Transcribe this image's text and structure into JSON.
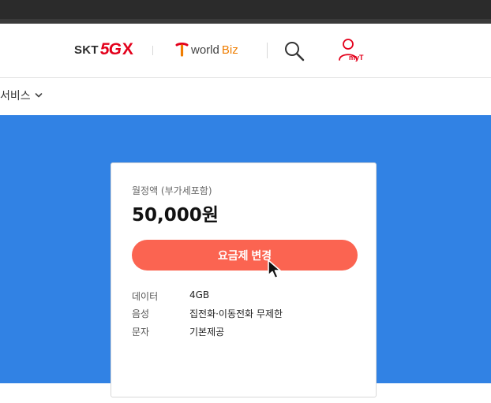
{
  "header": {
    "skt_logo": {
      "prefix": "SKT",
      "fiveg": "5G",
      "x": "X"
    },
    "worldbiz_logo": {
      "world": "world",
      "biz": "Biz"
    },
    "my_label": "myT"
  },
  "nav": {
    "services_label": "서비스"
  },
  "plan_card": {
    "price_label": "월정액 (부가세포함)",
    "price": "50,000원",
    "change_button": "요금제 변경",
    "specs": [
      {
        "label": "데이터",
        "value": "4GB"
      },
      {
        "label": "음성",
        "value": "집전화·이동전화 무제한"
      },
      {
        "label": "문자",
        "value": "기본제공"
      }
    ]
  },
  "colors": {
    "hero_bg": "#3182e4",
    "button_bg": "#fb6451",
    "brand_red": "#e3001b",
    "biz_orange": "#ef7d00"
  },
  "icons": [
    "search-icon",
    "user-icon",
    "chevron-down-icon",
    "t-logo-icon",
    "mouse-cursor-icon"
  ]
}
